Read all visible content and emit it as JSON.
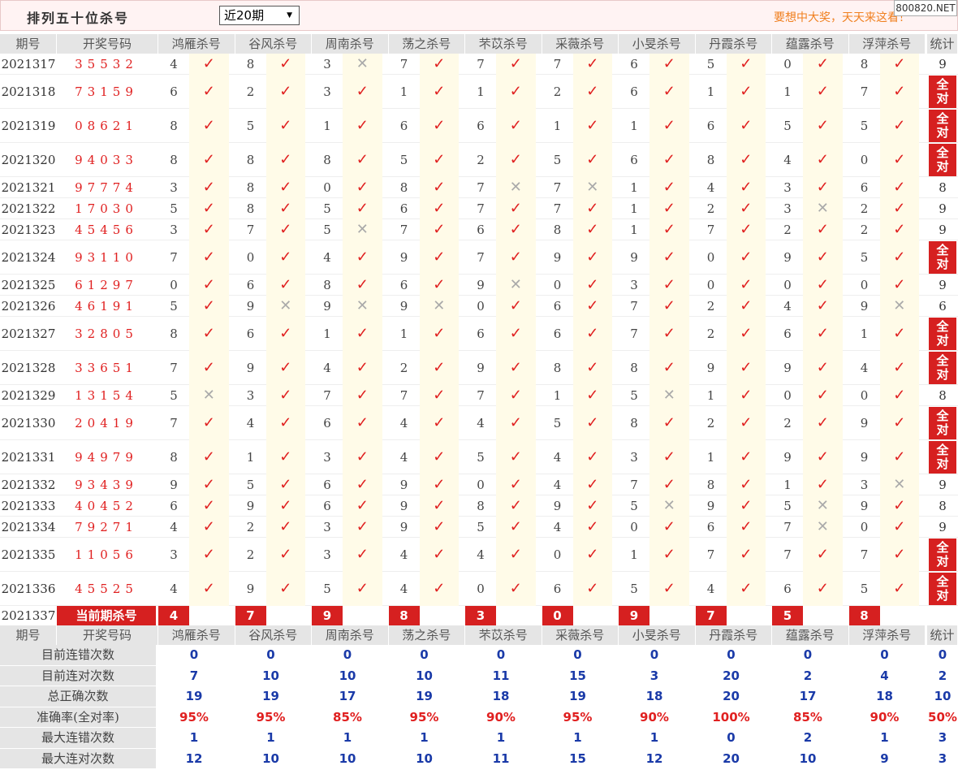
{
  "header": {
    "title": "排列五十位杀号",
    "select_value": "近20期",
    "select_arrow": "▼",
    "slogan": "要想中大奖，天天来这看！",
    "watermark": "800820.NET"
  },
  "icons": {
    "correct": "check-mark",
    "wrong": "cross-mark"
  },
  "columns": {
    "issue": "期号",
    "draw": "开奖号码",
    "experts": [
      "鸿雁杀号",
      "谷风杀号",
      "周南杀号",
      "荡之杀号",
      "芣苡杀号",
      "采薇杀号",
      "小旻杀号",
      "丹霞杀号",
      "蕴露杀号",
      "浮萍杀号"
    ],
    "stat": "统计"
  },
  "all_correct_text": "全对",
  "rows": [
    {
      "issue": "2021317",
      "draw": "35532",
      "kills": [
        "4",
        "8",
        "3",
        "7",
        "7",
        "7",
        "6",
        "5",
        "0",
        "8"
      ],
      "ok": [
        1,
        1,
        0,
        1,
        1,
        1,
        1,
        1,
        1,
        1
      ],
      "stat": "9"
    },
    {
      "issue": "2021318",
      "draw": "73159",
      "kills": [
        "6",
        "2",
        "3",
        "1",
        "1",
        "2",
        "6",
        "1",
        "1",
        "7"
      ],
      "ok": [
        1,
        1,
        1,
        1,
        1,
        1,
        1,
        1,
        1,
        1
      ],
      "stat": "全对"
    },
    {
      "issue": "2021319",
      "draw": "08621",
      "kills": [
        "8",
        "5",
        "1",
        "6",
        "6",
        "1",
        "1",
        "6",
        "5",
        "5"
      ],
      "ok": [
        1,
        1,
        1,
        1,
        1,
        1,
        1,
        1,
        1,
        1
      ],
      "stat": "全对"
    },
    {
      "issue": "2021320",
      "draw": "94033",
      "kills": [
        "8",
        "8",
        "8",
        "5",
        "2",
        "5",
        "6",
        "8",
        "4",
        "0"
      ],
      "ok": [
        1,
        1,
        1,
        1,
        1,
        1,
        1,
        1,
        1,
        1
      ],
      "stat": "全对"
    },
    {
      "issue": "2021321",
      "draw": "97774",
      "kills": [
        "3",
        "8",
        "0",
        "8",
        "7",
        "7",
        "1",
        "4",
        "3",
        "6"
      ],
      "ok": [
        1,
        1,
        1,
        1,
        0,
        0,
        1,
        1,
        1,
        1
      ],
      "stat": "8"
    },
    {
      "issue": "2021322",
      "draw": "17030",
      "kills": [
        "5",
        "8",
        "5",
        "6",
        "7",
        "7",
        "1",
        "2",
        "3",
        "2"
      ],
      "ok": [
        1,
        1,
        1,
        1,
        1,
        1,
        1,
        1,
        0,
        1
      ],
      "stat": "9"
    },
    {
      "issue": "2021323",
      "draw": "45456",
      "kills": [
        "3",
        "7",
        "5",
        "7",
        "6",
        "8",
        "1",
        "7",
        "2",
        "2"
      ],
      "ok": [
        1,
        1,
        0,
        1,
        1,
        1,
        1,
        1,
        1,
        1
      ],
      "stat": "9"
    },
    {
      "issue": "2021324",
      "draw": "93110",
      "kills": [
        "7",
        "0",
        "4",
        "9",
        "7",
        "9",
        "9",
        "0",
        "9",
        "5"
      ],
      "ok": [
        1,
        1,
        1,
        1,
        1,
        1,
        1,
        1,
        1,
        1
      ],
      "stat": "全对"
    },
    {
      "issue": "2021325",
      "draw": "61297",
      "kills": [
        "0",
        "6",
        "8",
        "6",
        "9",
        "0",
        "3",
        "0",
        "0",
        "0"
      ],
      "ok": [
        1,
        1,
        1,
        1,
        0,
        1,
        1,
        1,
        1,
        1
      ],
      "stat": "9"
    },
    {
      "issue": "2021326",
      "draw": "46191",
      "kills": [
        "5",
        "9",
        "9",
        "9",
        "0",
        "6",
        "7",
        "2",
        "4",
        "9"
      ],
      "ok": [
        1,
        0,
        0,
        0,
        1,
        1,
        1,
        1,
        1,
        0
      ],
      "stat": "6"
    },
    {
      "issue": "2021327",
      "draw": "32805",
      "kills": [
        "8",
        "6",
        "1",
        "1",
        "6",
        "6",
        "7",
        "2",
        "6",
        "1"
      ],
      "ok": [
        1,
        1,
        1,
        1,
        1,
        1,
        1,
        1,
        1,
        1
      ],
      "stat": "全对"
    },
    {
      "issue": "2021328",
      "draw": "33651",
      "kills": [
        "7",
        "9",
        "4",
        "2",
        "9",
        "8",
        "8",
        "9",
        "9",
        "4"
      ],
      "ok": [
        1,
        1,
        1,
        1,
        1,
        1,
        1,
        1,
        1,
        1
      ],
      "stat": "全对"
    },
    {
      "issue": "2021329",
      "draw": "13154",
      "kills": [
        "5",
        "3",
        "7",
        "7",
        "7",
        "1",
        "5",
        "1",
        "0",
        "0"
      ],
      "ok": [
        0,
        1,
        1,
        1,
        1,
        1,
        0,
        1,
        1,
        1
      ],
      "stat": "8"
    },
    {
      "issue": "2021330",
      "draw": "20419",
      "kills": [
        "7",
        "4",
        "6",
        "4",
        "4",
        "5",
        "8",
        "2",
        "2",
        "9"
      ],
      "ok": [
        1,
        1,
        1,
        1,
        1,
        1,
        1,
        1,
        1,
        1
      ],
      "stat": "全对"
    },
    {
      "issue": "2021331",
      "draw": "94979",
      "kills": [
        "8",
        "1",
        "3",
        "4",
        "5",
        "4",
        "3",
        "1",
        "9",
        "9"
      ],
      "ok": [
        1,
        1,
        1,
        1,
        1,
        1,
        1,
        1,
        1,
        1
      ],
      "stat": "全对"
    },
    {
      "issue": "2021332",
      "draw": "93439",
      "kills": [
        "9",
        "5",
        "6",
        "9",
        "0",
        "4",
        "7",
        "8",
        "1",
        "3"
      ],
      "ok": [
        1,
        1,
        1,
        1,
        1,
        1,
        1,
        1,
        1,
        0
      ],
      "stat": "9"
    },
    {
      "issue": "2021333",
      "draw": "40452",
      "kills": [
        "6",
        "9",
        "6",
        "9",
        "8",
        "9",
        "5",
        "9",
        "5",
        "9"
      ],
      "ok": [
        1,
        1,
        1,
        1,
        1,
        1,
        0,
        1,
        0,
        1
      ],
      "stat": "8"
    },
    {
      "issue": "2021334",
      "draw": "79271",
      "kills": [
        "4",
        "2",
        "3",
        "9",
        "5",
        "4",
        "0",
        "6",
        "7",
        "0"
      ],
      "ok": [
        1,
        1,
        1,
        1,
        1,
        1,
        1,
        1,
        0,
        1
      ],
      "stat": "9"
    },
    {
      "issue": "2021335",
      "draw": "11056",
      "kills": [
        "3",
        "2",
        "3",
        "4",
        "4",
        "0",
        "1",
        "7",
        "7",
        "7"
      ],
      "ok": [
        1,
        1,
        1,
        1,
        1,
        1,
        1,
        1,
        1,
        1
      ],
      "stat": "全对"
    },
    {
      "issue": "2021336",
      "draw": "45525",
      "kills": [
        "4",
        "9",
        "5",
        "4",
        "0",
        "6",
        "5",
        "4",
        "6",
        "5"
      ],
      "ok": [
        1,
        1,
        1,
        1,
        1,
        1,
        1,
        1,
        1,
        1
      ],
      "stat": "全对"
    }
  ],
  "current": {
    "issue": "2021337",
    "label": "当前期杀号",
    "kills": [
      "4",
      "7",
      "9",
      "8",
      "3",
      "0",
      "9",
      "7",
      "5",
      "8"
    ]
  },
  "summary": [
    {
      "label": "目前连错次数",
      "values": [
        "0",
        "0",
        "0",
        "0",
        "0",
        "0",
        "0",
        "0",
        "0",
        "0"
      ],
      "stat": "0",
      "red": false
    },
    {
      "label": "目前连对次数",
      "values": [
        "7",
        "10",
        "10",
        "10",
        "11",
        "15",
        "3",
        "20",
        "2",
        "4"
      ],
      "stat": "2",
      "red": false
    },
    {
      "label": "总正确次数",
      "values": [
        "19",
        "19",
        "17",
        "19",
        "18",
        "19",
        "18",
        "20",
        "17",
        "18"
      ],
      "stat": "10",
      "red": false
    },
    {
      "label": "准确率(全对率)",
      "values": [
        "95%",
        "95%",
        "85%",
        "95%",
        "90%",
        "95%",
        "90%",
        "100%",
        "85%",
        "90%"
      ],
      "stat": "50%",
      "red": true
    },
    {
      "label": "最大连错次数",
      "values": [
        "1",
        "1",
        "1",
        "1",
        "1",
        "1",
        "1",
        "0",
        "2",
        "1"
      ],
      "stat": "3",
      "red": false
    },
    {
      "label": "最大连对次数",
      "values": [
        "12",
        "10",
        "10",
        "10",
        "11",
        "15",
        "12",
        "20",
        "10",
        "9"
      ],
      "stat": "3",
      "red": false
    }
  ]
}
